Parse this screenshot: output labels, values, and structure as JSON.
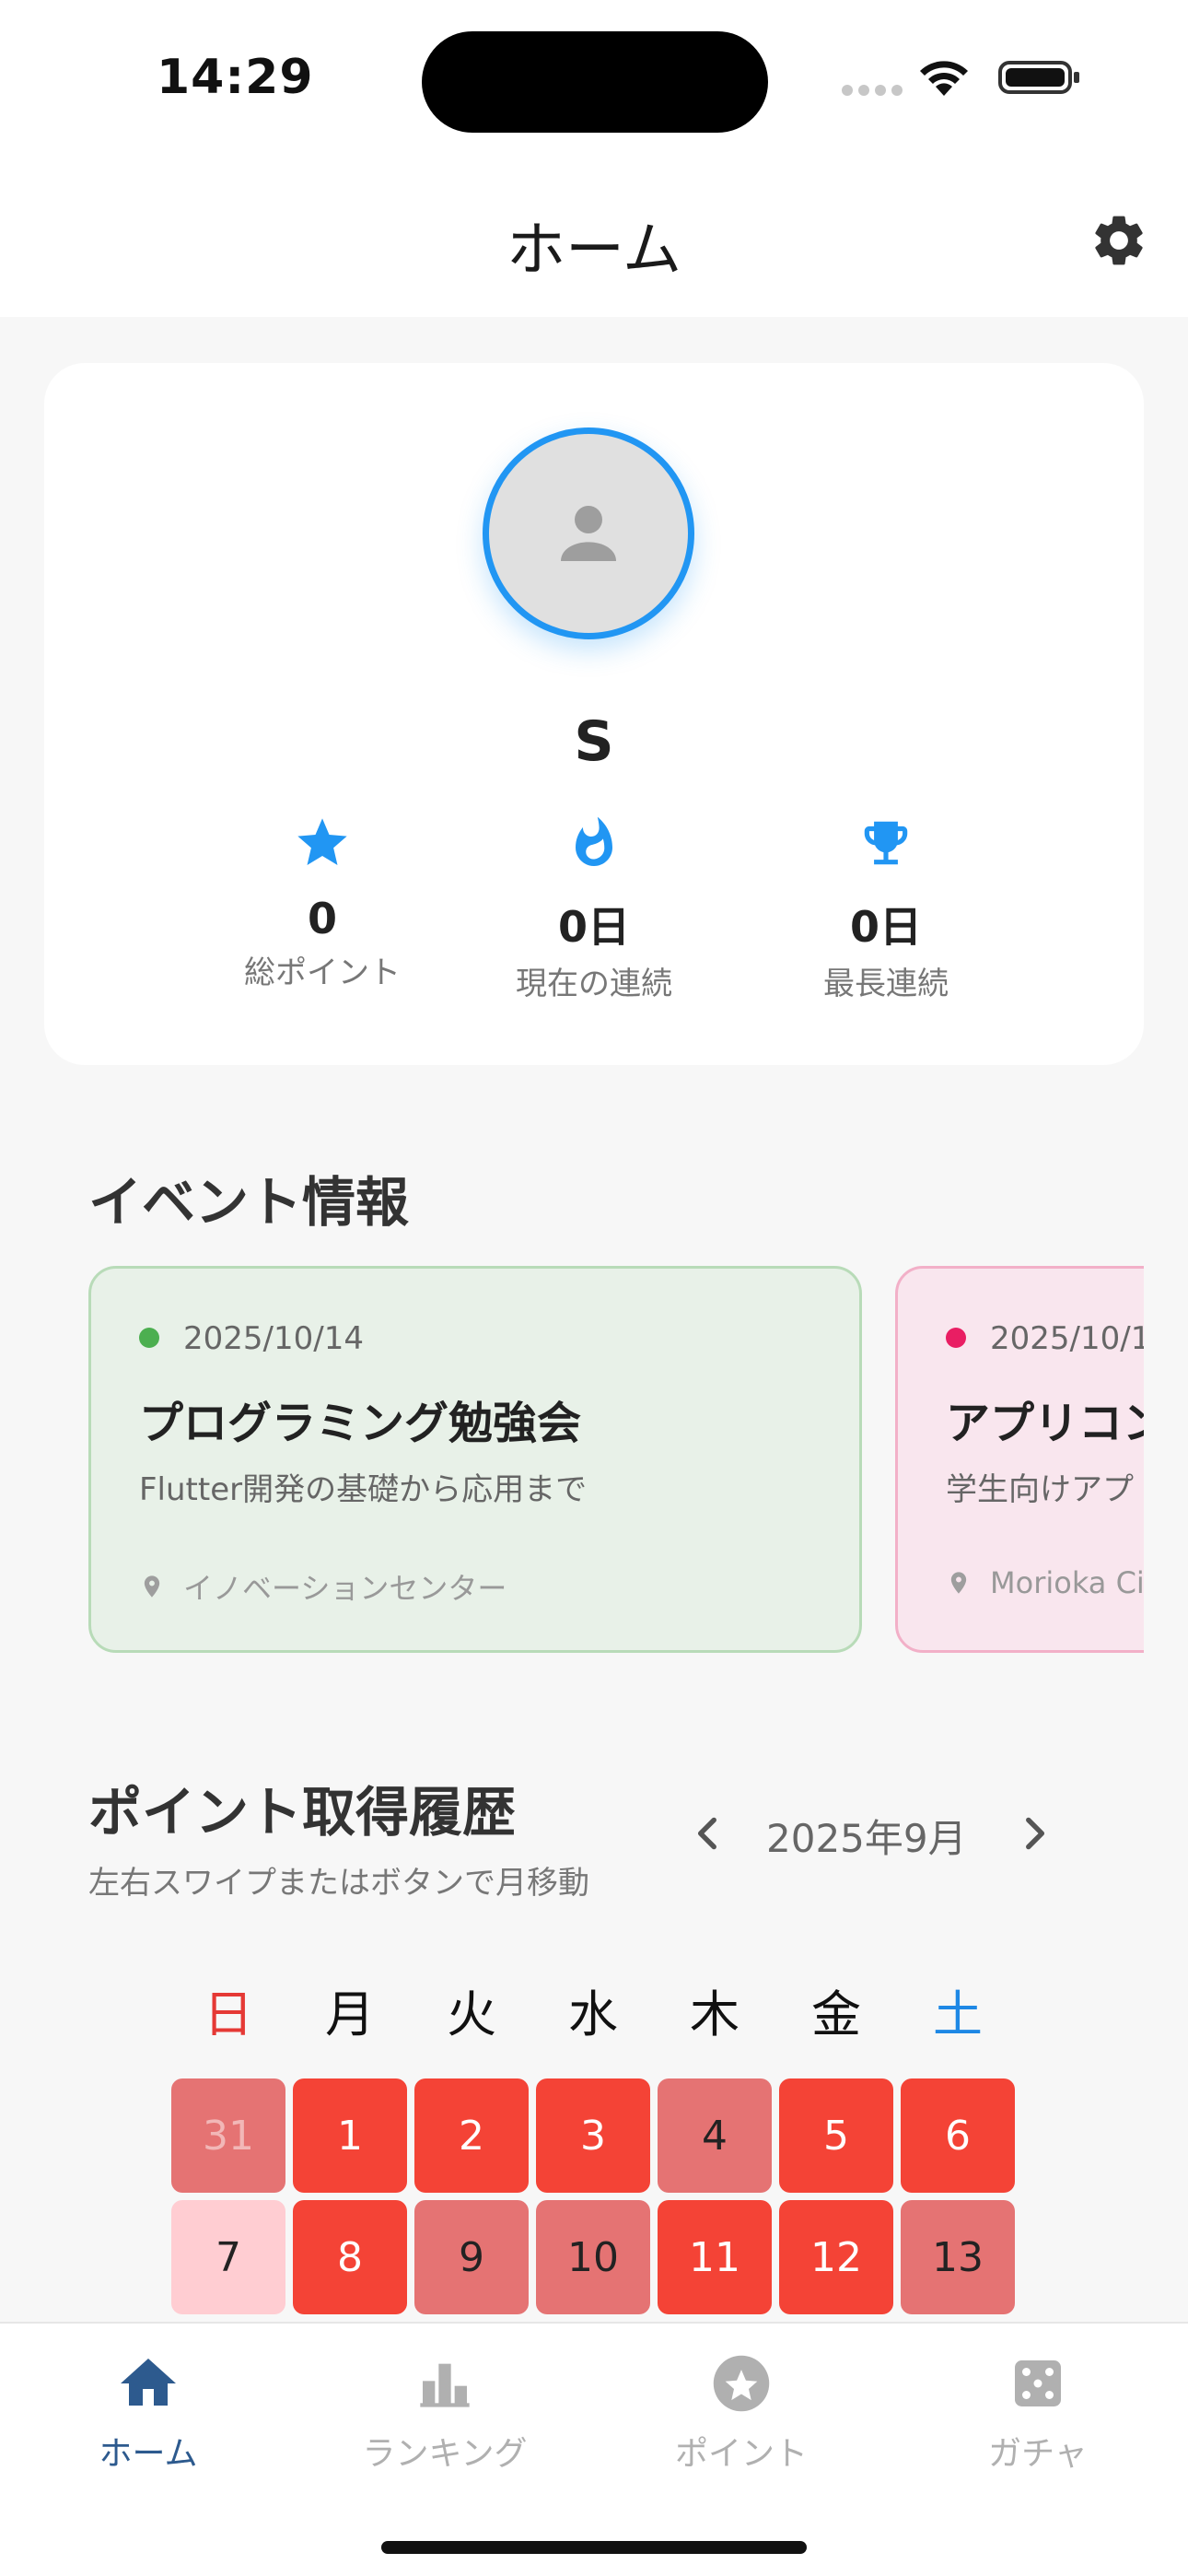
{
  "status_bar": {
    "time": "14:29"
  },
  "app_bar": {
    "title": "ホーム"
  },
  "profile": {
    "name": "S",
    "stats": [
      {
        "icon": "star-icon",
        "value": "0",
        "label": "総ポイント"
      },
      {
        "icon": "flame-icon",
        "value": "0日",
        "label": "現在の連続"
      },
      {
        "icon": "trophy-icon",
        "value": "0日",
        "label": "最長連続"
      }
    ]
  },
  "events": {
    "title": "イベント情報",
    "items": [
      {
        "date": "2025/10/14",
        "title": "プログラミング勉強会",
        "description": "Flutter開発の基礎から応用まで",
        "location": "イノベーションセンター",
        "dot_color": "#4caf50"
      },
      {
        "date": "2025/10/1",
        "title": "アプリコン",
        "description": "学生向けアプ",
        "location": "Morioka Ci",
        "dot_color": "#e91e63"
      }
    ]
  },
  "history": {
    "title": "ポイント取得履歴",
    "subtitle": "左右スワイプまたはボタンで月移動",
    "month": "2025年9月",
    "weekdays": [
      "日",
      "月",
      "火",
      "水",
      "木",
      "金",
      "土"
    ],
    "weeks": [
      [
        {
          "day": "31",
          "level": "outside"
        },
        {
          "day": "1",
          "level": "high"
        },
        {
          "day": "2",
          "level": "high"
        },
        {
          "day": "3",
          "level": "high"
        },
        {
          "day": "4",
          "level": "mid"
        },
        {
          "day": "5",
          "level": "high"
        },
        {
          "day": "6",
          "level": "high"
        }
      ],
      [
        {
          "day": "7",
          "level": "low"
        },
        {
          "day": "8",
          "level": "high"
        },
        {
          "day": "9",
          "level": "mid"
        },
        {
          "day": "10",
          "level": "mid"
        },
        {
          "day": "11",
          "level": "high"
        },
        {
          "day": "12",
          "level": "high"
        },
        {
          "day": "13",
          "level": "mid"
        }
      ]
    ]
  },
  "bottom_nav": {
    "items": [
      {
        "label": "ホーム",
        "icon": "home-icon",
        "active": true
      },
      {
        "label": "ランキング",
        "icon": "bar-chart-icon",
        "active": false
      },
      {
        "label": "ポイント",
        "icon": "star-circle-icon",
        "active": false
      },
      {
        "label": "ガチャ",
        "icon": "dice-icon",
        "active": false
      }
    ]
  },
  "colors": {
    "accent": "#2196f3",
    "nav_active": "#2d5a8e",
    "nav_inactive": "#b0b0b0",
    "sunday": "#e53935",
    "saturday": "#1e88e5",
    "heat_high": "#f44336",
    "heat_mid": "#e57373",
    "heat_low": "#ffcdd2",
    "heat_outside": "#e57373"
  }
}
